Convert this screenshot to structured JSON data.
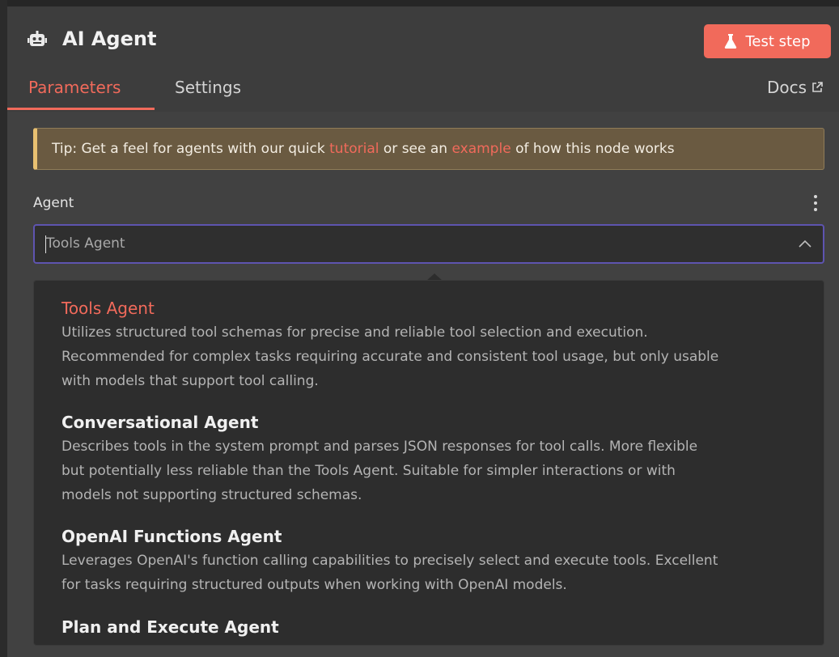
{
  "node": {
    "title": "AI Agent",
    "test_button_label": "Test step"
  },
  "tabs": [
    {
      "label": "Parameters",
      "active": true
    },
    {
      "label": "Settings",
      "active": false
    }
  ],
  "docs_label": "Docs",
  "tip": {
    "prefix": "Tip: Get a feel for agents with our quick ",
    "link1": "tutorial",
    "middle": " or see an ",
    "link2": "example",
    "suffix": " of how this node works"
  },
  "agent_field": {
    "label": "Agent",
    "value": "Tools Agent"
  },
  "options": [
    {
      "title": "Tools Agent",
      "selected": true,
      "lines": [
        "Utilizes structured tool schemas for precise and reliable tool selection and execution.",
        "Recommended for complex tasks requiring accurate and consistent tool usage, but only usable",
        "with models that support tool calling."
      ]
    },
    {
      "title": "Conversational Agent",
      "selected": false,
      "lines": [
        "Describes tools in the system prompt and parses JSON responses for tool calls. More flexible",
        "but potentially less reliable than the Tools Agent. Suitable for simpler interactions or with",
        "models not supporting structured schemas."
      ]
    },
    {
      "title": "OpenAI Functions Agent",
      "selected": false,
      "lines": [
        "Leverages OpenAI's function calling capabilities to precisely select and execute tools. Excellent",
        "for tasks requiring structured outputs when working with OpenAI models."
      ]
    },
    {
      "title": "Plan and Execute Agent",
      "selected": false,
      "lines": []
    }
  ],
  "colors": {
    "accent": "#f16a5b",
    "tip_background": "#6a5a41",
    "tip_border": "#e8c071",
    "focus_border": "#5e54b0"
  }
}
